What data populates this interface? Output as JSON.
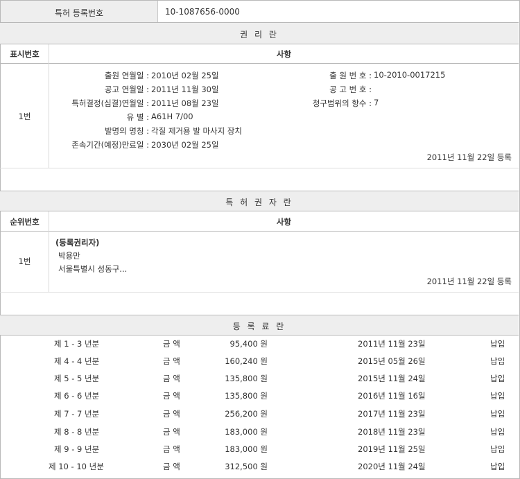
{
  "top": {
    "label": "특허 등록번호",
    "number": "10-1087656-0000"
  },
  "rights_section": {
    "title": "권 리 란",
    "col_num": "표시번호",
    "col_item": "사항",
    "row_num": "1번",
    "left_fields": [
      {
        "label": "출원 연월일 :",
        "value": "2010년 02월 25일"
      },
      {
        "label": "공고 연월일 :",
        "value": "2011년 11월 30일"
      },
      {
        "label": "특허결정(심결)연월일 :",
        "value": "2011년 08월 23일"
      },
      {
        "label": "유 별 :",
        "value": "A61H 7/00"
      },
      {
        "label": "발명의 명칭 :",
        "value": "각질 제거용 발 마사지 장치"
      },
      {
        "label": "존속기간(예정)만료일 :",
        "value": "2030년 02월 25일"
      }
    ],
    "right_fields": [
      {
        "label": "출 원 번 호 :",
        "value": "10-2010-0017215"
      },
      {
        "label": "공 고 번 호 :",
        "value": ""
      },
      {
        "label": "청구범위의 항수 :",
        "value": "7"
      }
    ],
    "registered": "2011년 11월 22일 등록"
  },
  "holder_section": {
    "title": "특 허 권 자 란",
    "col_num": "순위번호",
    "col_item": "사항",
    "row_num": "1번",
    "heading": "(등록권리자)",
    "name": "박용만",
    "address": "서울특별시 성동구...",
    "registered": "2011년 11월 22일 등록"
  },
  "fee_section": {
    "title": "등 록 료 란",
    "rows": [
      {
        "period": "제 1 - 3 년분",
        "kind": "금 액",
        "amount": "95,400 원",
        "date": "2011년 11월 23일",
        "status": "납입"
      },
      {
        "period": "제 4 - 4 년분",
        "kind": "금 액",
        "amount": "160,240 원",
        "date": "2015년 05월 26일",
        "status": "납입"
      },
      {
        "period": "제 5 - 5 년분",
        "kind": "금 액",
        "amount": "135,800 원",
        "date": "2015년 11월 24일",
        "status": "납입"
      },
      {
        "period": "제 6 - 6 년분",
        "kind": "금 액",
        "amount": "135,800 원",
        "date": "2016년 11월 16일",
        "status": "납입"
      },
      {
        "period": "제 7 - 7 년분",
        "kind": "금 액",
        "amount": "256,200 원",
        "date": "2017년 11월 23일",
        "status": "납입"
      },
      {
        "period": "제 8 - 8 년분",
        "kind": "금 액",
        "amount": "183,000 원",
        "date": "2018년 11월 23일",
        "status": "납입"
      },
      {
        "period": "제 9 - 9 년분",
        "kind": "금 액",
        "amount": "183,000 원",
        "date": "2019년 11월 25일",
        "status": "납입"
      },
      {
        "period": "제 10 - 10 년분",
        "kind": "금 액",
        "amount": "312,500 원",
        "date": "2020년 11월 24일",
        "status": "납입"
      }
    ]
  },
  "colors": {
    "header_bg": "#eeeeee",
    "border": "#b8b8b8",
    "text": "#333333"
  }
}
